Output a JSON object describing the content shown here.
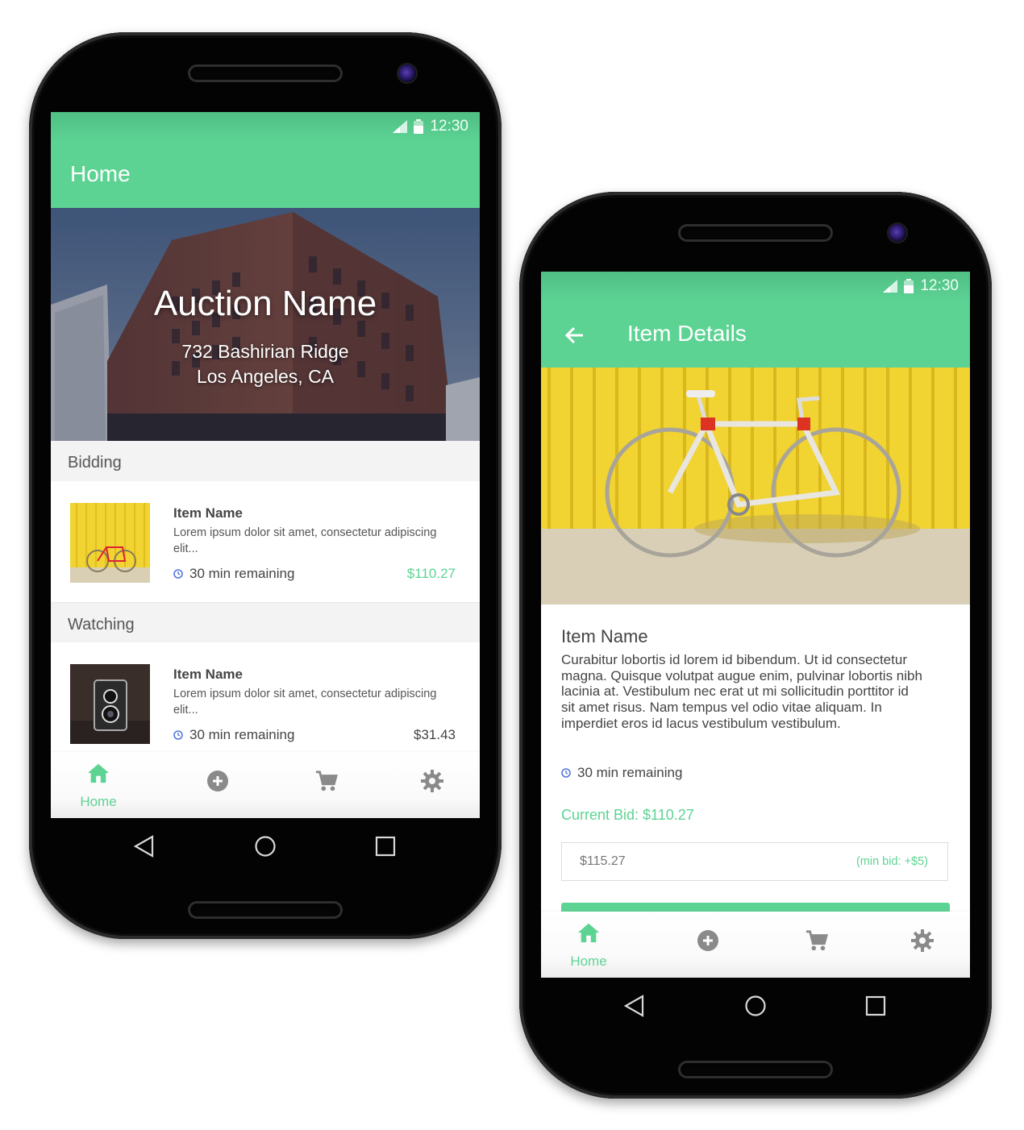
{
  "colors": {
    "accent": "#5dd393",
    "price_alt": "#444444",
    "clock": "#5577dd"
  },
  "status": {
    "time": "12:30"
  },
  "home_screen": {
    "title": "Home",
    "hero": {
      "title": "Auction Name",
      "address_line1": "732 Bashirian Ridge",
      "address_line2": "Los Angeles, CA"
    },
    "sections": [
      {
        "header": "Bidding",
        "item": {
          "name": "Item Name",
          "description": "Lorem ipsum dolor sit amet, consectetur adipiscing elit...",
          "time": "30 min remaining",
          "price": "$110.27",
          "thumbnail": "bicycle-photo"
        }
      },
      {
        "header": "Watching",
        "item": {
          "name": "Item Name",
          "description": "Lorem ipsum dolor sit amet, consectetur adipiscing elit...",
          "time": "30 min remaining",
          "price": "$31.43",
          "thumbnail": "camera-photo"
        }
      }
    ]
  },
  "details_screen": {
    "title": "Item Details",
    "item_name": "Item Name",
    "description": "Curabitur lobortis id lorem id bibendum. Ut id consectetur magna. Quisque volutpat augue enim, pulvinar lobortis nibh lacinia at. Vestibulum nec erat ut mi sollicitudin porttitor id sit amet risus. Nam tempus vel odio vitae aliquam. In imperdiet eros id lacus vestibulum vestibulum.",
    "time": "30 min remaining",
    "current_bid": "Current Bid: $110.27",
    "bid_input_value": "$115.27",
    "bid_hint": "(min bid: +$5)"
  },
  "bottom_nav": {
    "home_label": "Home",
    "icons": [
      "home-icon",
      "add-circle-icon",
      "cart-icon",
      "settings-icon"
    ]
  },
  "android_nav": {
    "icons": [
      "back-triangle-icon",
      "home-circle-icon",
      "recents-square-icon"
    ]
  }
}
